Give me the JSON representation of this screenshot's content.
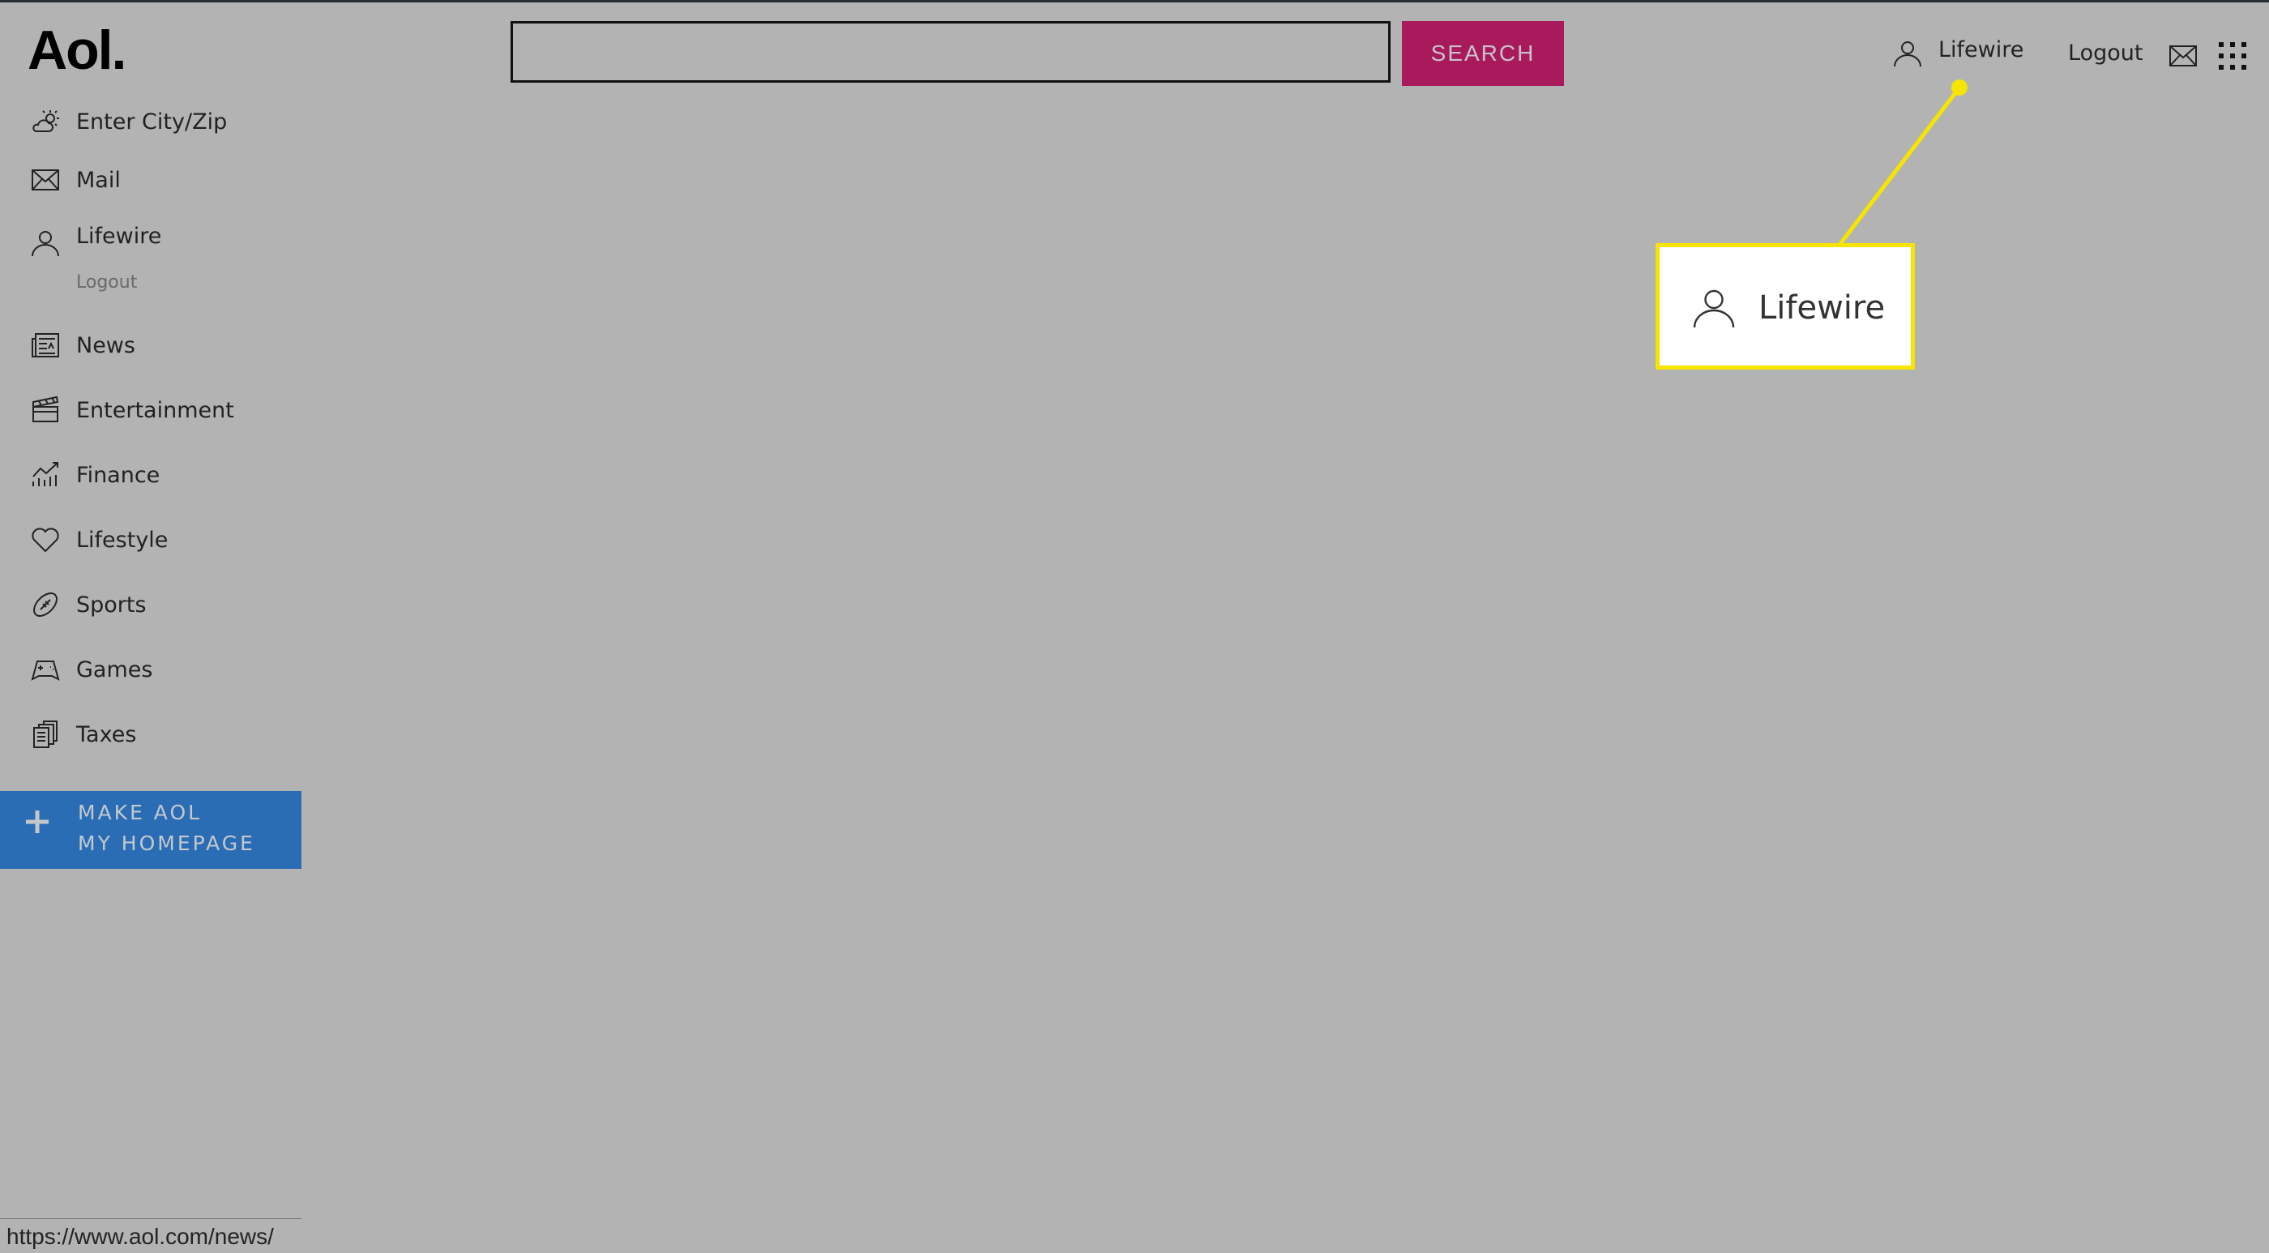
{
  "header": {
    "logo": "Aol.",
    "search": {
      "value": "",
      "placeholder": "",
      "button_label": "SEARCH"
    },
    "user_label": "Lifewire",
    "logout_label": "Logout",
    "icons": [
      "user-icon",
      "mail-icon",
      "apps-grid-icon"
    ]
  },
  "sidebar": {
    "items": [
      {
        "label": "Enter City/Zip",
        "icon": "weather-icon"
      },
      {
        "label": "Mail",
        "icon": "mail-icon"
      },
      {
        "label": "Lifewire",
        "icon": "user-icon",
        "sub_label": "Logout"
      },
      {
        "label": "News",
        "icon": "newspaper-icon"
      },
      {
        "label": "Entertainment",
        "icon": "clapperboard-icon"
      },
      {
        "label": "Finance",
        "icon": "chart-icon"
      },
      {
        "label": "Lifestyle",
        "icon": "heart-icon"
      },
      {
        "label": "Sports",
        "icon": "football-icon"
      },
      {
        "label": "Games",
        "icon": "gamepad-icon"
      },
      {
        "label": "Taxes",
        "icon": "documents-icon"
      }
    ],
    "homepage_button": {
      "line1": "MAKE AOL",
      "line2": "MY HOMEPAGE"
    }
  },
  "callout": {
    "label": "Lifewire",
    "color": "#f7e500"
  },
  "status_bar": {
    "url": "https://www.aol.com/news/"
  },
  "colors": {
    "background": "#b3b3b3",
    "search_button": "#a81a5c",
    "homepage_button": "#2a6db5"
  }
}
